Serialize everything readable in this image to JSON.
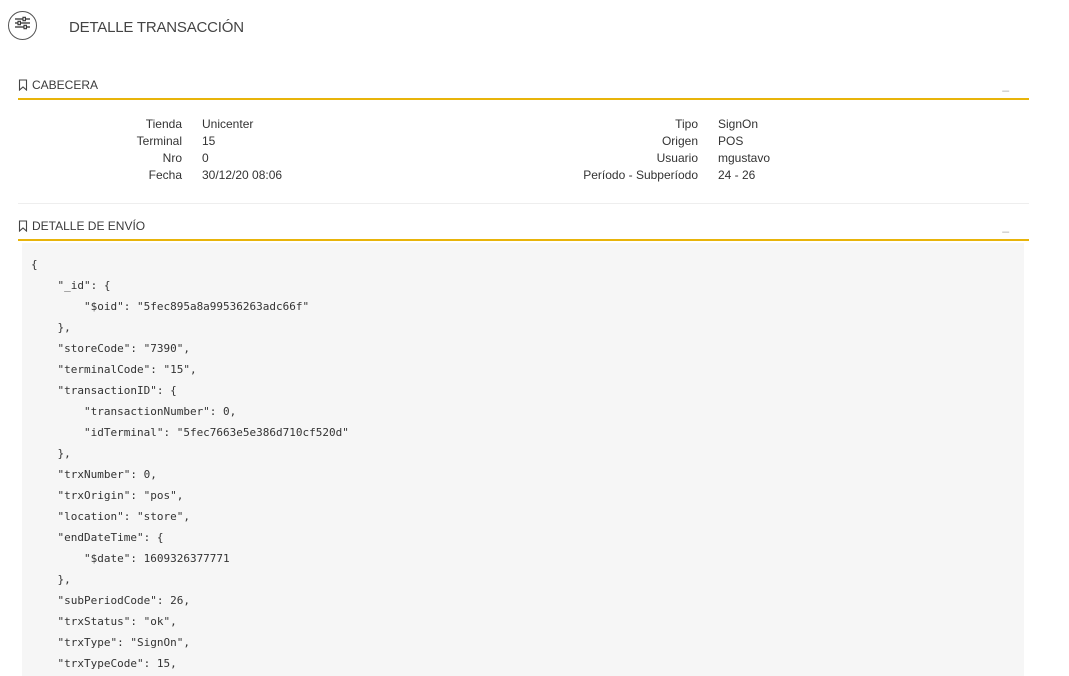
{
  "header": {
    "menu_icon": "sliders-icon",
    "title": "DETALLE TRANSACCIÓN"
  },
  "sections": {
    "cabecera": {
      "title": "CABECERA",
      "collapse_symbol": "_",
      "left_fields": [
        {
          "label": "Tienda",
          "value": "Unicenter"
        },
        {
          "label": "Terminal",
          "value": "15"
        },
        {
          "label": "Nro",
          "value": "0"
        },
        {
          "label": "Fecha",
          "value": "30/12/20 08:06"
        }
      ],
      "right_fields": [
        {
          "label": "Tipo",
          "value": "SignOn"
        },
        {
          "label": "Origen",
          "value": "POS"
        },
        {
          "label": "Usuario",
          "value": "mgustavo"
        },
        {
          "label": "Período - Subperíodo",
          "value": "24 - 26"
        }
      ]
    },
    "detalle_envio": {
      "title": "DETALLE DE ENVÍO",
      "collapse_symbol": "_",
      "json_lines": [
        "{",
        "    \"_id\": {",
        "        \"$oid\": \"5fec895a8a99536263adc66f\"",
        "    },",
        "    \"storeCode\": \"7390\",",
        "    \"terminalCode\": \"15\",",
        "    \"transactionID\": {",
        "        \"transactionNumber\": 0,",
        "        \"idTerminal\": \"5fec7663e5e386d710cf520d\"",
        "    },",
        "    \"trxNumber\": 0,",
        "    \"trxOrigin\": \"pos\",",
        "    \"location\": \"store\",",
        "    \"endDateTime\": {",
        "        \"$date\": 1609326377771",
        "    },",
        "    \"subPeriodCode\": 26,",
        "    \"trxStatus\": \"ok\",",
        "    \"trxType\": \"SignOn\",",
        "    \"trxTypeCode\": 15,"
      ]
    }
  },
  "colors": {
    "accent": "#e8b40a",
    "code_background": "#f6f6f6"
  }
}
